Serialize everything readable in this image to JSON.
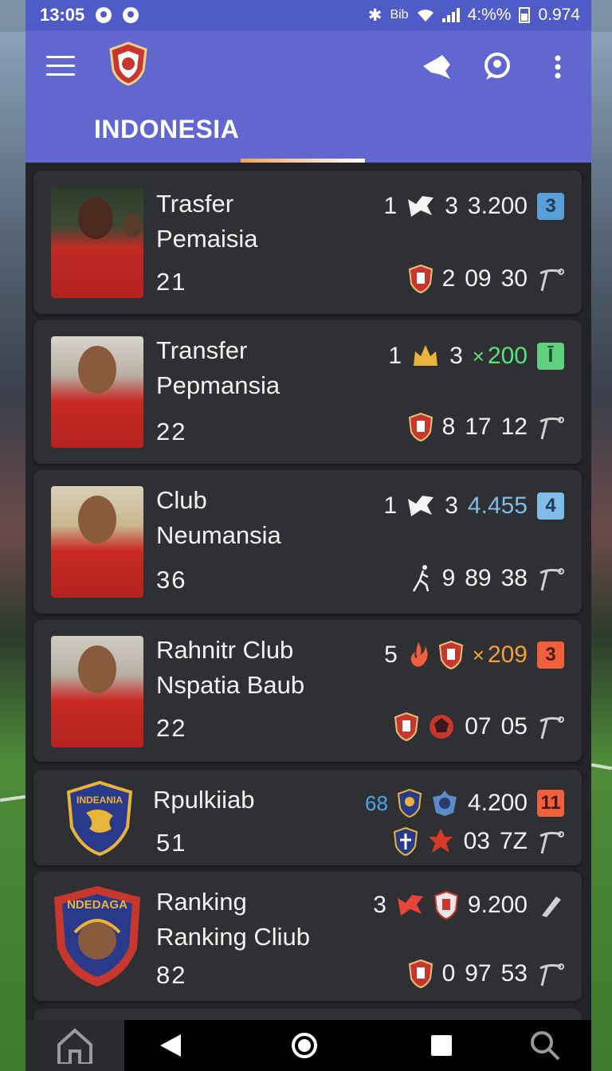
{
  "status_bar": {
    "time": "13:05",
    "right_text": "4:%%",
    "battery_text": "0.974",
    "icons": [
      "notification-icon",
      "sync-icon",
      "bluetooth-icon",
      "network-text",
      "wifi-icon",
      "signal-icon",
      "battery-icon"
    ],
    "network_label": "Bib"
  },
  "app_bar": {
    "tab_label": "INDONESIA",
    "icons": [
      "menu-icon",
      "club-logo",
      "share-icon",
      "chat-icon",
      "more-vert-icon"
    ],
    "accent": "#6167cf"
  },
  "cards": [
    {
      "name_line1": "Trasfer",
      "name_line2": "Pemaisia",
      "score": "21",
      "row1": {
        "num": "1",
        "icon": "boot-icon",
        "num2": "3",
        "value": "3.200",
        "value_color": "#f2f2f2",
        "badge": "3",
        "badge_color": "#5aa0d8"
      },
      "row2": {
        "num": "2",
        "val1": "09",
        "val2": "30",
        "icon": "crest-icon"
      }
    },
    {
      "name_line1": "Transfer",
      "name_line2": "Pepmansia",
      "score": "22",
      "row1": {
        "num": "1",
        "icon": "crown-icon",
        "num2": "3",
        "prefix": "×",
        "value": "200",
        "value_color": "#5be07a",
        "badge": "Ī",
        "badge_color": "#5fd080"
      },
      "row2": {
        "num": "8",
        "val1": "17",
        "val2": "12",
        "icon": "crest-icon"
      }
    },
    {
      "name_line1": "Club",
      "name_line2": "Neumansia",
      "score": "36",
      "row1": {
        "num": "1",
        "icon": "boot-icon",
        "num2": "3",
        "value": "4.455",
        "value_color": "#7fbce8",
        "badge": "4",
        "badge_color": "#7fbce8"
      },
      "row2": {
        "num": "9",
        "val1": "89",
        "val2": "38",
        "icon": "runner-icon"
      }
    },
    {
      "name_line1": "Rahnitr Club",
      "name_line2": "Nspatia Baub",
      "score": "22",
      "row1": {
        "num": "5",
        "icon": "flame-icon",
        "prefix": "×",
        "value": "209",
        "value_color": "#f2a03c",
        "badge": "3",
        "badge_color": "#f0603c"
      },
      "row2": {
        "val1": "07",
        "val2": "05",
        "icon": "crest-icon"
      }
    },
    {
      "name_line1": "Rpulkiiab",
      "score": "51",
      "row1": {
        "num": "68",
        "num_color": "#4aa6f0",
        "value": "4.200",
        "value_color": "#f2f2f2",
        "badge": "11",
        "badge_color": "#f0603c"
      },
      "row2": {
        "val1": "03",
        "val2": "7Z"
      },
      "club_crest_text": "INDEANIA"
    },
    {
      "name_line1": "Ranking",
      "name_line2": "Ranking Cliub",
      "score": "82",
      "row1": {
        "num": "3",
        "icon": "boot-icon",
        "value": "9.200",
        "value_color": "#f2f2f2"
      },
      "row2": {
        "num": "0",
        "val1": "97",
        "val2": "53",
        "icon": "crest-icon"
      },
      "club_crest_text": "NDEDAGA"
    }
  ],
  "bottom_nav": {
    "items": [
      "home-icon",
      "back-icon",
      "home-circle-icon",
      "recents-icon",
      "search-icon"
    ]
  }
}
